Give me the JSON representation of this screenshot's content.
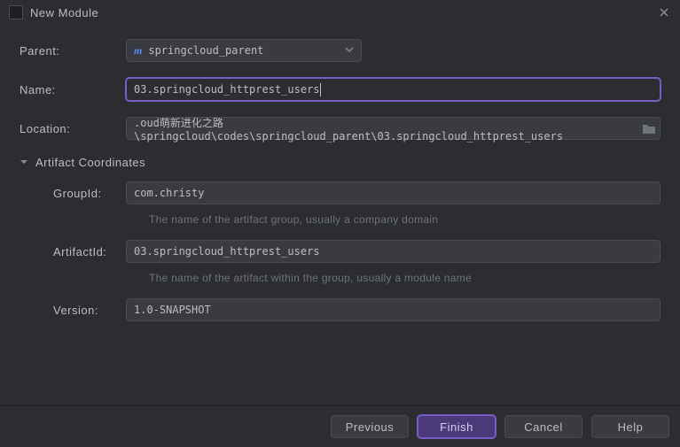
{
  "window": {
    "title": "New Module"
  },
  "labels": {
    "parent": "Parent:",
    "name": "Name:",
    "location": "Location:",
    "artifact_coords": "Artifact Coordinates",
    "group_id": "GroupId:",
    "artifact_id": "ArtifactId:",
    "version": "Version:"
  },
  "values": {
    "parent": "springcloud_parent",
    "name": "03.springcloud_httprest_users",
    "location": ".oud萌新进化之路\\springcloud\\codes\\springcloud_parent\\03.springcloud_httprest_users",
    "group_id": "com.christy",
    "artifact_id": "03.springcloud_httprest_users",
    "version": "1.0-SNAPSHOT"
  },
  "hints": {
    "group_id": "The name of the artifact group, usually a company domain",
    "artifact_id": "The name of the artifact within the group, usually a module name"
  },
  "buttons": {
    "previous": "Previous",
    "finish": "Finish",
    "cancel": "Cancel",
    "help": "Help"
  }
}
